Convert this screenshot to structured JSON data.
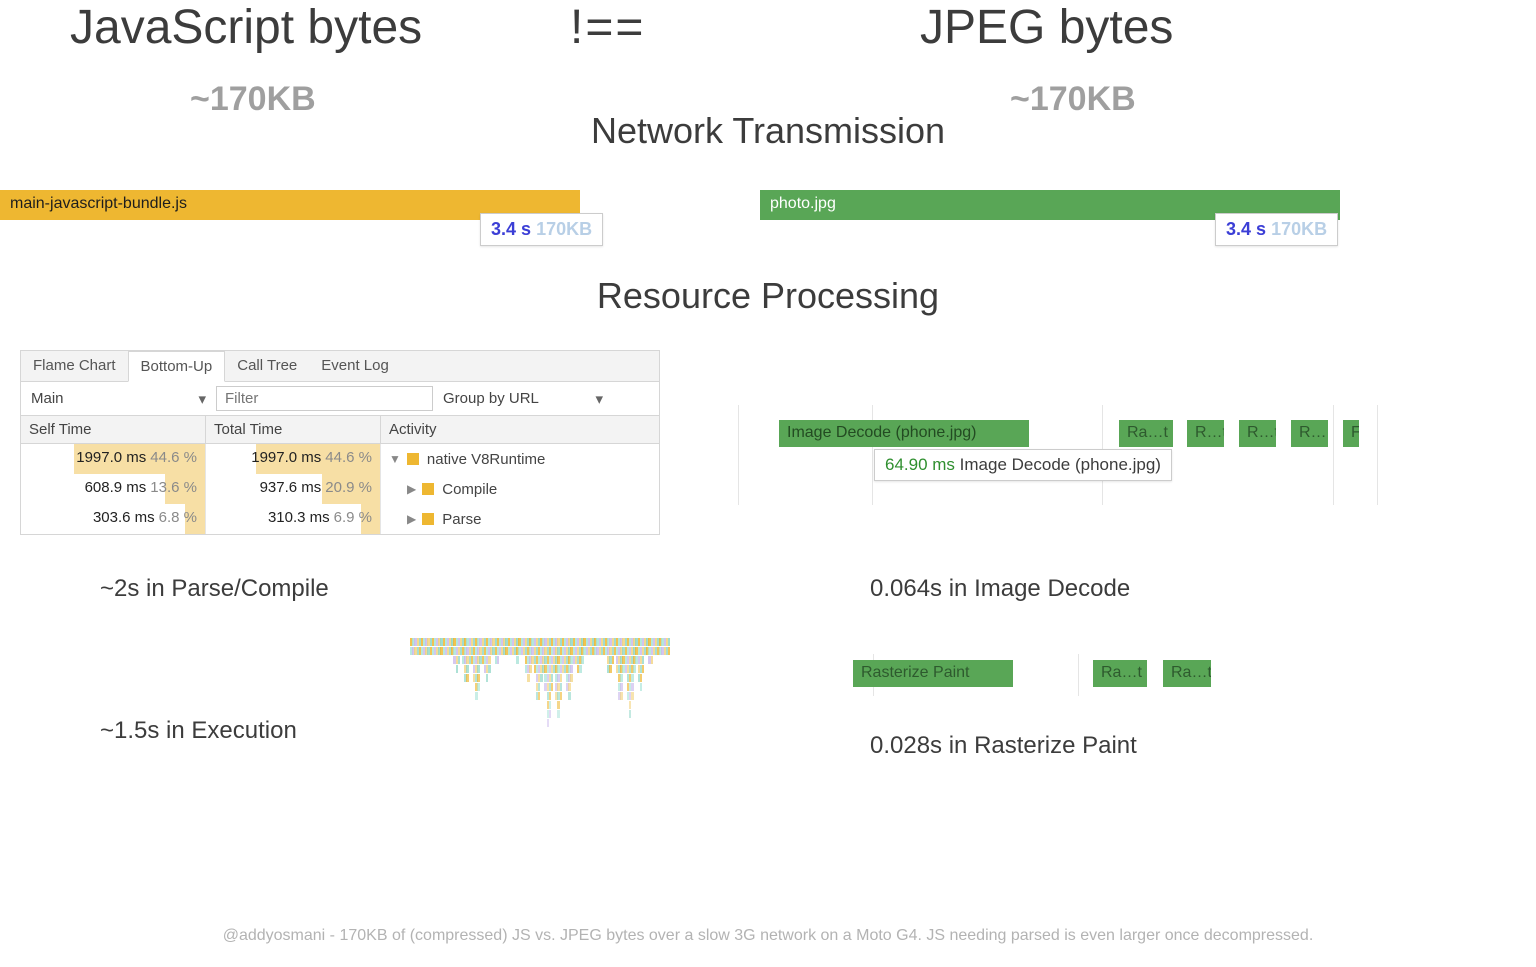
{
  "title": {
    "left": "JavaScript bytes",
    "mid": "!==",
    "right": "JPEG bytes"
  },
  "size": {
    "left": "~170KB",
    "right": "~170KB"
  },
  "section": {
    "net": "Network Transmission",
    "proc": "Resource Processing"
  },
  "net_bar": {
    "js": "main-javascript-bundle.js",
    "jpg": "photo.jpg"
  },
  "net_badge": {
    "js": {
      "time": "3.4 s",
      "size": "170KB"
    },
    "jpg": {
      "time": "3.4 s",
      "size": "170KB"
    }
  },
  "devtools": {
    "tabs": [
      "Flame Chart",
      "Bottom-Up",
      "Call Tree",
      "Event Log"
    ],
    "active_tab": "Bottom-Up",
    "select_main": "Main",
    "filter_placeholder": "Filter",
    "group": "Group by URL",
    "cols": {
      "self": "Self Time",
      "total": "Total Time",
      "activity": "Activity"
    },
    "rows": [
      {
        "self_ms": "1997.0 ms",
        "self_pct": "44.6 %",
        "self_bar": 44.6,
        "total_ms": "1997.0 ms",
        "total_pct": "44.6 %",
        "total_bar": 44.6,
        "activity": "native V8Runtime",
        "arrow": "▼",
        "indent": 0
      },
      {
        "self_ms": "608.9 ms",
        "self_pct": "13.6 %",
        "self_bar": 13.6,
        "total_ms": "937.6 ms",
        "total_pct": "20.9 %",
        "total_bar": 20.9,
        "activity": "Compile",
        "arrow": "▶",
        "indent": 1
      },
      {
        "self_ms": "303.6 ms",
        "self_pct": "6.8 %",
        "self_bar": 6.8,
        "total_ms": "310.3 ms",
        "total_pct": "6.9 %",
        "total_bar": 6.9,
        "activity": "Parse",
        "arrow": "▶",
        "indent": 1
      }
    ]
  },
  "decode": {
    "big": "Image Decode (phone.jpg)",
    "tip_ms": "64.90 ms",
    "tip_label": "Image Decode (phone.jpg)",
    "small": [
      "Ra…t",
      "R…t",
      "R…t",
      "R…",
      "F"
    ]
  },
  "raster": {
    "label": "Rasterize Paint",
    "small": [
      "Ra…t",
      "Ra…t"
    ]
  },
  "summary": {
    "parse": "~2s in Parse/Compile",
    "decode": "0.064s in Image Decode",
    "exec": "~1.5s in Execution",
    "raster": "0.028s in Rasterize Paint"
  },
  "caption": "@addyosmani - 170KB of (compressed) JS vs. JPEG bytes over a slow 3G network on a Moto G4. JS needing parsed is even larger once decompressed."
}
